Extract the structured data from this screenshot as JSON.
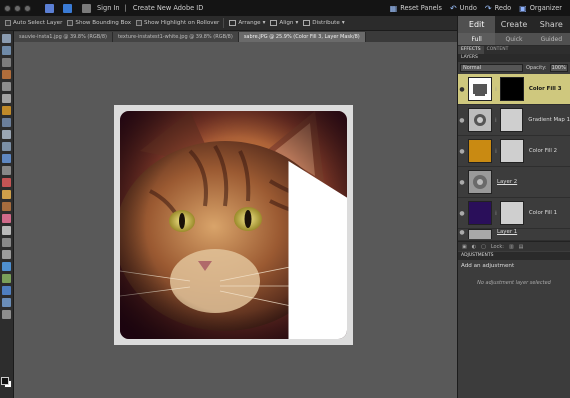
{
  "menubar": {
    "signin": "Sign In",
    "create_id": "Create New Adobe ID",
    "reset_panels": "Reset Panels",
    "undo": "Undo",
    "redo": "Redo",
    "organizer": "Organizer"
  },
  "options": {
    "auto_select": "Auto Select Layer",
    "bounding_box": "Show Bounding Box",
    "highlight": "Show Highlight on Rollover",
    "arrange": "Arrange",
    "align": "Align",
    "distribute": "Distribute"
  },
  "doc_tabs": [
    "sauvie-insta1.jpg @ 39.8% (RGB/8)",
    "texture-instatest1-white.jpg @ 39.8% (RGB/8)",
    "sabre.JPG @ 25.9% (Color Fill 3, Layer Mask/8)"
  ],
  "panel": {
    "modes": [
      "Edit",
      "Create",
      "Share"
    ],
    "submodes": [
      "Full",
      "Quick",
      "Guided"
    ],
    "panel_tabs": [
      "EFFECTS",
      "CONTENT"
    ],
    "layers_title": "LAYERS",
    "blend_mode": "Normal",
    "opacity_label": "Opacity:",
    "opacity_value": "100%",
    "layers": [
      {
        "name": "Color Fill 3",
        "selected": true
      },
      {
        "name": "Gradient Map 1",
        "selected": false
      },
      {
        "name": "Color Fill 2",
        "selected": false
      },
      {
        "name": "Layer 2",
        "selected": false
      },
      {
        "name": "Color Fill 1",
        "selected": false
      },
      {
        "name": "Layer 1",
        "selected": false
      }
    ],
    "lock_label": "Lock:",
    "adjustments_title": "ADJUSTMENTS",
    "add_adjustment": "Add an adjustment",
    "no_adjustment": "No adjustment layer selected"
  },
  "colors": {
    "selected_layer": "#cfc87e",
    "fill_orange": "#c98a12",
    "fill_purple": "#2a0f5a"
  }
}
